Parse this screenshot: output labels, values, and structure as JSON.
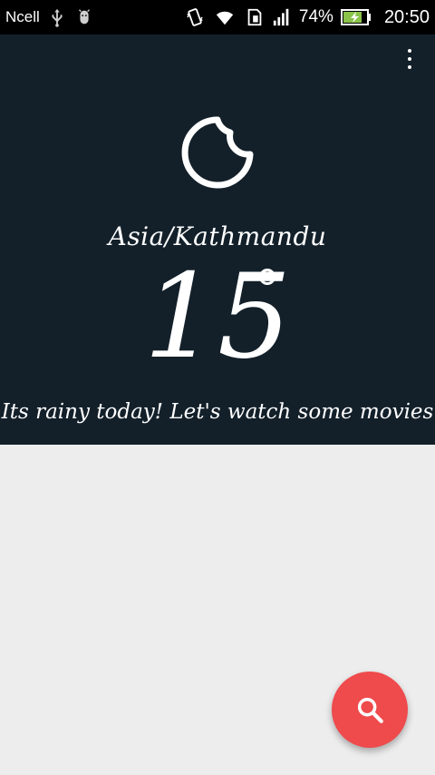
{
  "status_bar": {
    "carrier": "Ncell",
    "battery_percent": "74%",
    "time": "20:50",
    "icons": [
      "usb-icon",
      "android-debug-icon",
      "vibrate-icon",
      "wifi-icon",
      "sim-icon",
      "signal-icon",
      "battery-charging-icon"
    ]
  },
  "header": {
    "location": "Asia/Kathmandu",
    "temperature": "15",
    "message": "Its rainy today! Let's watch some movies",
    "weather_icon": "moon-icon",
    "menu_icon": "overflow-menu-icon",
    "background_color": "#13202a"
  },
  "fab": {
    "icon": "search-icon",
    "color": "#ef4a4c"
  }
}
